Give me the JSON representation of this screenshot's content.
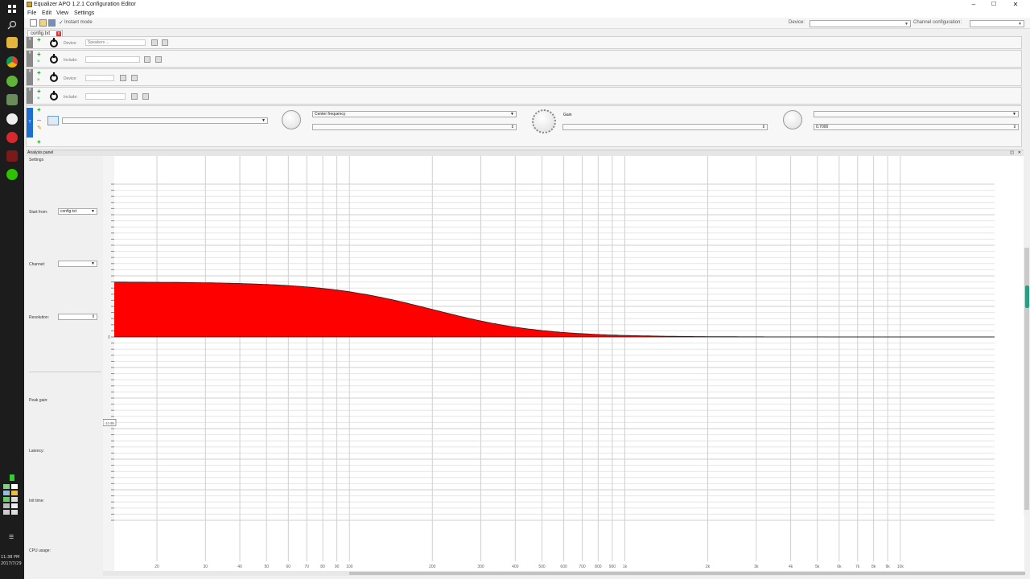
{
  "taskbar": {
    "clock_time": "11:38 PM",
    "clock_date": "2017/7/29"
  },
  "window": {
    "title": "Equalizer APO 1.2.1 Configuration Editor",
    "minimize": "–",
    "maximize": "☐",
    "close": "✕"
  },
  "menu": {
    "file": "File",
    "edit": "Edit",
    "view": "View",
    "settings": "Settings"
  },
  "toolbar": {
    "instant_mode_label": "Instant mode",
    "device_label": "Device:",
    "device_value": "",
    "channel_config_label": "Channel configuration:",
    "channel_config_value": ""
  },
  "tab": {
    "label": "config.txt",
    "close": "x"
  },
  "rows": [
    {
      "marker": "#",
      "label": "Device:",
      "field": "Speakers ...",
      "color": "#888888"
    },
    {
      "marker": "#",
      "label": "Include:",
      "field": "",
      "color": "#888888"
    },
    {
      "marker": "#",
      "label": "Device:",
      "field": "",
      "color": "#888888"
    },
    {
      "marker": "#",
      "label": "Include:",
      "field": "",
      "color": "#888888"
    }
  ],
  "filter_panel": {
    "marker": "T",
    "marker_color": "#1f6fd1",
    "filter_type": "",
    "freq_label": "Center frequency",
    "freq_value": "",
    "gain_label": "Gain",
    "gain_value": "",
    "q_label": "",
    "q_value": "0.7000"
  },
  "analysis": {
    "title": "Analysis panel",
    "settings_label": "Settings",
    "start_from_label": "Start from:",
    "start_from_value": "config.txt",
    "channel_label": "Channel:",
    "channel_value": "",
    "resolution_label": "Resolution:",
    "resolution_value": "",
    "peak_gain_label": "Peak gain:",
    "peak_gain_value": "",
    "latency_label": "Latency:",
    "latency_value": "",
    "init_time_label": "Init time:",
    "init_time_value": "",
    "cpu_usage_label": "CPU usage:",
    "cpu_usage_value": ""
  },
  "plot": {
    "fill_color": "#ff0000",
    "baseline_db": 0,
    "x_ticks": [
      "20",
      "30",
      "40",
      "50",
      "60",
      "70",
      "80",
      "90",
      "100",
      "200",
      "300",
      "400",
      "500",
      "600",
      "700",
      "800",
      "900",
      "1k",
      "2k",
      "3k",
      "4k",
      "5k",
      "6k",
      "7k",
      "8k",
      "9k",
      "10k"
    ],
    "y_zero_label": "0",
    "y_cursor_label": "-10 dB"
  },
  "curve": {
    "type": "low-shelf",
    "max_gain_db": 18,
    "corner_hz": 200
  },
  "watermark": ""
}
